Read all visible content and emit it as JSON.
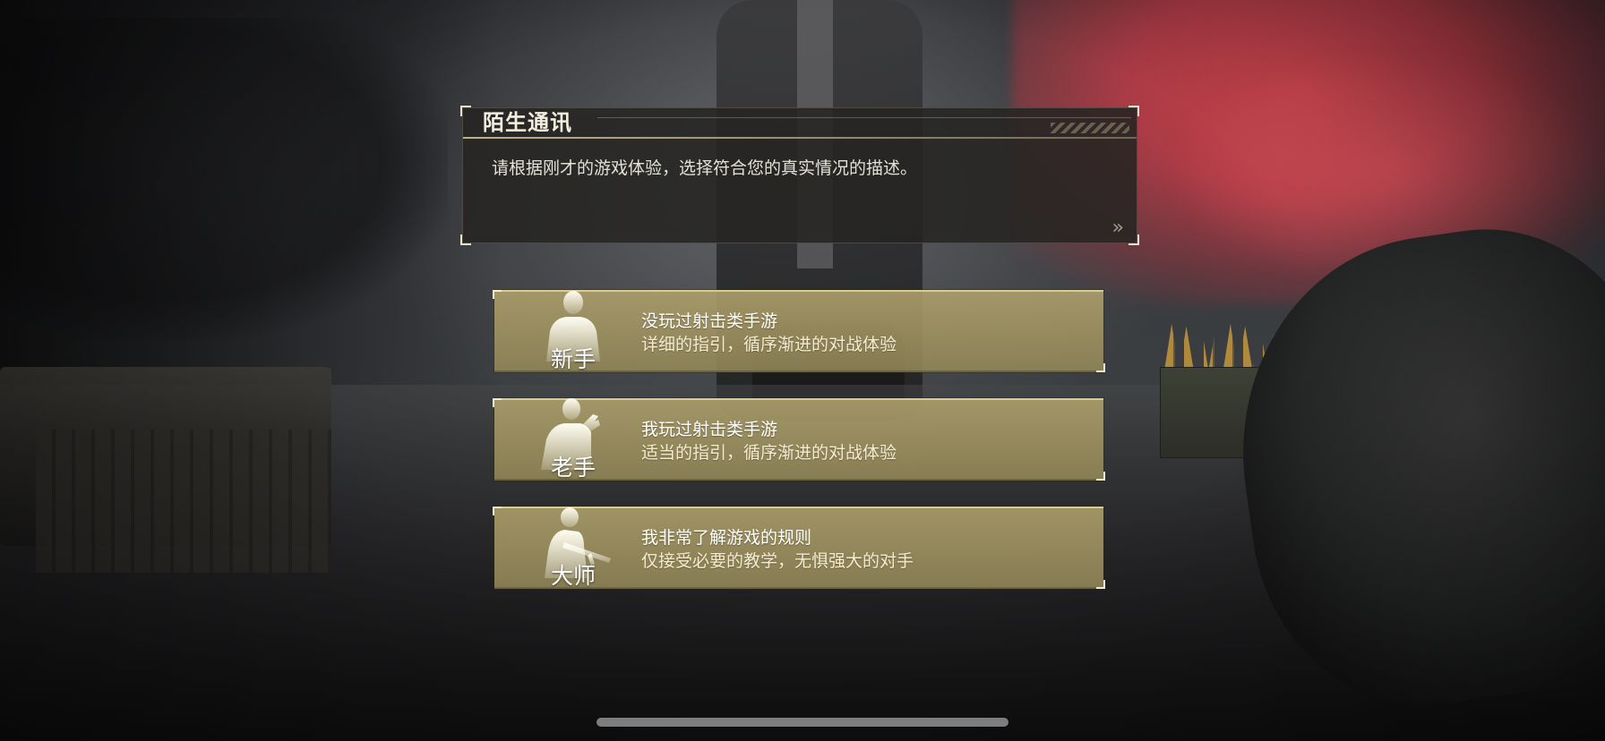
{
  "dialog": {
    "title": "陌生通讯",
    "body": "请根据刚才的游戏体验，选择符合您的真实情况的描述。",
    "next_icon": "double-chevron-right-icon",
    "next_glyph": "»"
  },
  "options": [
    {
      "rank": "新手",
      "title": "没玩过射击类手游",
      "subtitle": "详细的指引，循序渐进的对战体验",
      "icon": "standing-soldier-silhouette-icon"
    },
    {
      "rank": "老手",
      "title": "我玩过射击类手游",
      "subtitle": "适当的指引，循序渐进的对战体验",
      "icon": "soldier-with-pistol-silhouette-icon"
    },
    {
      "rank": "大师",
      "title": "我非常了解游戏的规则",
      "subtitle": "仅接受必要的教学，无惧强大的对手",
      "icon": "kneeling-soldier-with-rifle-silhouette-icon"
    }
  ],
  "colors": {
    "option_gold": "#b0a26c",
    "smoke_red": "#d74650",
    "text_white": "#ffffff"
  }
}
